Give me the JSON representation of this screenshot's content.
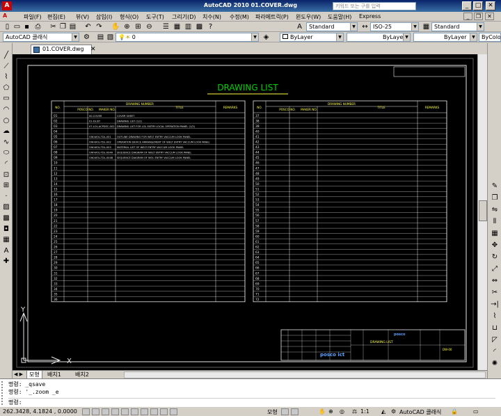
{
  "titlebar": {
    "title": "AutoCAD 2010    01.COVER.dwg",
    "search_placeholder": "키워드 또는 구를 입력",
    "app_icon": "A"
  },
  "menu": [
    "파일(F)",
    "편집(E)",
    "뷰(V)",
    "삽입(I)",
    "형식(O)",
    "도구(T)",
    "그리기(D)",
    "치수(N)",
    "수정(M)",
    "파라메트릭(P)",
    "윈도우(W)",
    "도움말(H)",
    "Express"
  ],
  "toolbar": {
    "text_style": "Standard",
    "dim_style": "ISO-25",
    "table_style": "Standard",
    "workspace": "AutoCAD 클래식",
    "layer": "0",
    "color": "ByLayer",
    "linetype": "ByLayer",
    "lineweight": "ByLayer",
    "plot_style": "ByColor"
  },
  "tab": {
    "file": "01.COVER.dwg"
  },
  "drawing": {
    "title": "DRAWING LIST",
    "headers": {
      "no": "NO.",
      "group": "DRAWING NUMBER",
      "posco": "POSCO NO.",
      "maker": "MAKER NO.",
      "title": "TITLE",
      "remarks": "REMARKS"
    },
    "left_rows": [
      {
        "no": "01",
        "maker": "00-COVER",
        "title": "COVER SHEET"
      },
      {
        "no": "02",
        "maker": "01-DLIST",
        "title": "DRAWING LIST (1/2)"
      },
      {
        "no": "03",
        "maker": "07-LOL-ACPDEC-002",
        "title": "DRAWING LIST FOR LOL ENTRY LOCAL OPERATION PANEL (1/2)"
      },
      {
        "no": "04",
        "maker": "",
        "title": ""
      },
      {
        "no": "05",
        "maker": "OW-WOL-TDL-001",
        "title": "OUTLINE DRAWING FOR WELT ENTRY VACCUM LOOK PANEL"
      },
      {
        "no": "06",
        "maker": "OW-WOL-TDL-002",
        "title": "OPERATION DEVICE ARRANGEMENT OF WELT ENTRY VACCUM LOOK PANEL"
      },
      {
        "no": "07",
        "maker": "OW-WOL-TDL-003",
        "title": "MATERIAL LIST OF WELT ENTRY VACCUM LOOK PANEL"
      },
      {
        "no": "08",
        "maker": "OW-WOL-TDL-004A",
        "title": "SEQUENCE DIAGRAM OF WELT ENTRY VACCUM LOOK PANEL"
      },
      {
        "no": "09",
        "maker": "OW-WOL-TDL-004B",
        "title": "SEQUENCE DIAGRAM OF WOL ENTRY VACCUM LOOK PANEL"
      }
    ],
    "left_numbers_rest": [
      "10",
      "11",
      "12",
      "13",
      "14",
      "15",
      "16",
      "17",
      "18",
      "19",
      "20",
      "21",
      "22",
      "23",
      "24",
      "25",
      "26",
      "27",
      "28",
      "29",
      "30",
      "31",
      "32",
      "33",
      "34",
      "35",
      "36"
    ],
    "right_numbers": [
      "37",
      "38",
      "39",
      "40",
      "41",
      "42",
      "43",
      "44",
      "45",
      "46",
      "47",
      "48",
      "49",
      "50",
      "51",
      "52",
      "53",
      "54",
      "55",
      "56",
      "57",
      "58",
      "59",
      "60",
      "61",
      "62",
      "63",
      "64",
      "65",
      "66",
      "67",
      "68",
      "69",
      "70",
      "71",
      "72"
    ],
    "titleblock": {
      "project_title": "DRAWING LIST",
      "company": "posco ict",
      "logo_text": "posco",
      "dwg_no": "DW-00"
    },
    "ucs": {
      "x": "X",
      "y": "Y"
    }
  },
  "layout_tabs": [
    "모형",
    "배치1",
    "배치2"
  ],
  "command_lines": [
    "명령: _qsave",
    "명령: '_.zoom _e",
    "명령:"
  ],
  "status": {
    "coords": "262.3428, 4.1824 , 0.0000",
    "model": "모형",
    "scale": "1:1",
    "workspace": "AutoCAD 클래식"
  }
}
